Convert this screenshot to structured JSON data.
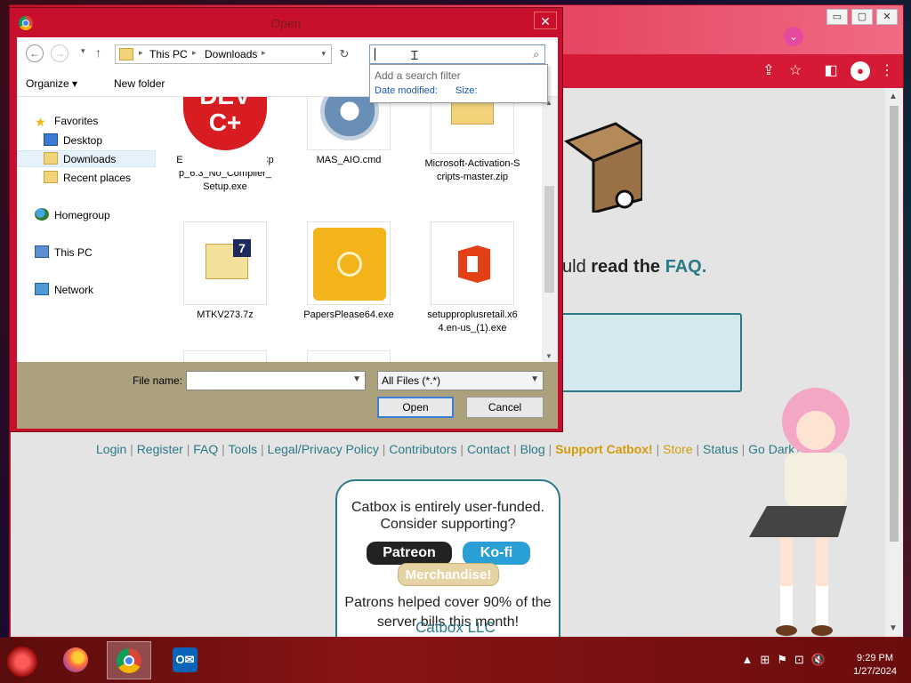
{
  "dialog": {
    "title": "Open",
    "close_glyph": "✕",
    "nav": {
      "back_glyph": "←",
      "forward_glyph": "→",
      "dropdown_glyph": "▾",
      "up_glyph": "↑",
      "refresh_glyph": "↻"
    },
    "breadcrumb": [
      "This PC",
      "Downloads"
    ],
    "breadcrumb_sep": "▸",
    "search": {
      "value": "",
      "filter_title": "Add a search filter",
      "filters": [
        "Date modified:",
        "Size:"
      ]
    },
    "toolbar": {
      "organize_label": "Organize ▾",
      "new_folder_label": "New folder"
    },
    "nav_pane": {
      "favorites": "Favorites",
      "desktop": "Desktop",
      "downloads": "Downloads",
      "recent": "Recent places",
      "homegroup": "Homegroup",
      "this_pc": "This PC",
      "network": "Network"
    },
    "files": [
      {
        "name": "Embarcadero_Dev-Cpp_6.3_No_Compiler_Setup.exe",
        "icon": "devcpp-icon"
      },
      {
        "name": "MAS_AIO.cmd",
        "icon": "gear-icon"
      },
      {
        "name": "Microsoft-Activation-Scripts-master.zip",
        "icon": "zip-folder-icon"
      },
      {
        "name": "MTKV273.7z",
        "icon": "7z-archive-icon"
      },
      {
        "name": "PapersPlease64.exe",
        "icon": "papers-please-icon"
      },
      {
        "name": "setupproplusretail.x64.en-us_(1).exe",
        "icon": "office-icon"
      }
    ],
    "devcpp_text": "DEV C+",
    "sevenz_text": "7",
    "file_name_label": "File name:",
    "file_name_value": "",
    "file_type_value": "All Files (*.*)",
    "open_label": "Open",
    "cancel_label": "Cancel"
  },
  "browser": {
    "win_buttons": [
      "▭",
      "▢",
      "✕"
    ],
    "faq_prefix": "uld ",
    "faq_bold": "read the ",
    "faq_link": "FAQ.",
    "footer_links": [
      "Login",
      "Register",
      "FAQ",
      "Tools",
      "Legal/Privacy Policy",
      "Contributors",
      "Contact",
      "Blog",
      "Support Catbox!",
      "Store",
      "Status",
      "Go Dark?"
    ],
    "support_line1": "Catbox is entirely user-funded.",
    "support_line2": "Consider supporting?",
    "patreon_label": "Patreon",
    "kofi_label": "Ko-fi",
    "merch_label": "Merchandise!",
    "patrons_line1": "Patrons helped cover 90% of the",
    "patrons_line2": "server bills this month!",
    "company": "Catbox LLC"
  },
  "taskbar": {
    "apps": [
      "Firefox",
      "Chrome",
      "Outlook"
    ],
    "outlook_text": "O✉",
    "tray_icons": [
      "▲",
      "⊞",
      "⚑",
      "⊡",
      "🔇"
    ],
    "time": "9:29 PM",
    "date": "1/27/2024"
  },
  "colors": {
    "accent": "#c8102e",
    "catbox_teal": "#2b7a87",
    "support_gold": "#d49a0a"
  }
}
